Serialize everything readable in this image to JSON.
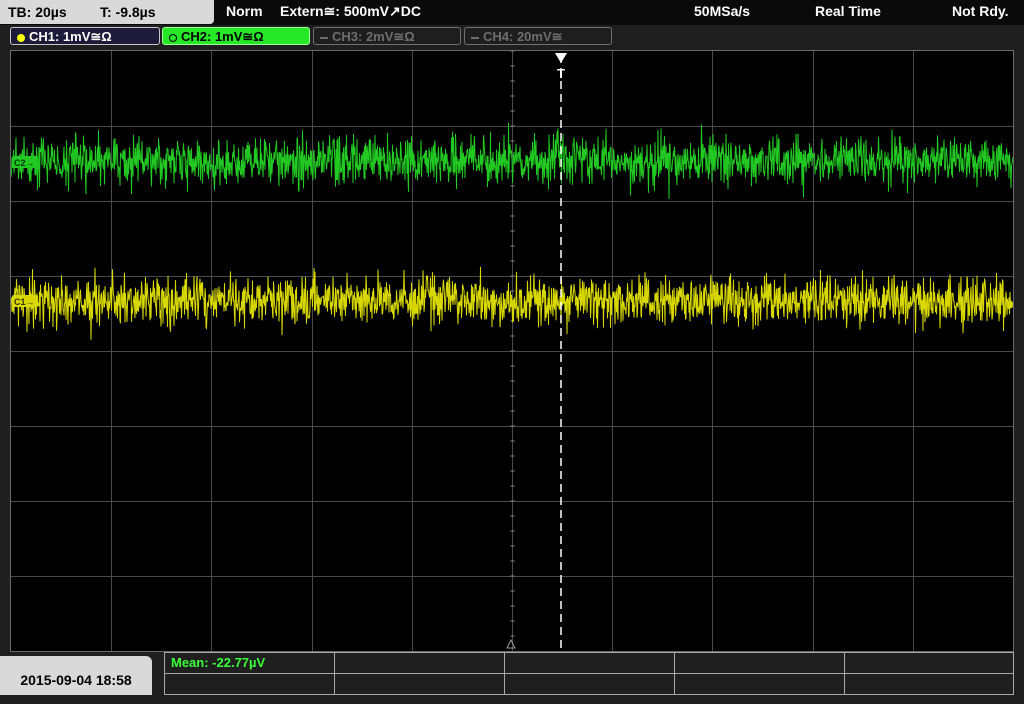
{
  "status_bar": {
    "timebase": "TB: 20µs",
    "trigger_time": "T: -9.8µs",
    "mode": "Norm",
    "trigger_source": "Extern≅: 500mV↗DC",
    "sample_rate": "50MSa/s",
    "acquisition": "Real Time",
    "state": "Not Rdy."
  },
  "channels": [
    {
      "label": "CH1: 1mV≅Ω",
      "color": "#e6e600",
      "active": true
    },
    {
      "label": "CH2: 1mV≅Ω",
      "color": "#2fd12f",
      "active": true,
      "selected": true
    },
    {
      "label": "CH3: 2mV≅Ω",
      "color": "#6e6e6e",
      "active": false
    },
    {
      "label": "CH4: 20mV≅",
      "color": "#6e6e6e",
      "active": false
    }
  ],
  "markers": {
    "ch2": "C2→",
    "ch1": "C1→",
    "trigger": "T"
  },
  "measurement": {
    "mean": "Mean: -22.77µV"
  },
  "datetime": "2015-09-04 18:58",
  "colors": {
    "ch1": "#d8d800",
    "ch2": "#22c922",
    "grid": "#4a4a4a",
    "trigger": "#ffffff"
  }
}
